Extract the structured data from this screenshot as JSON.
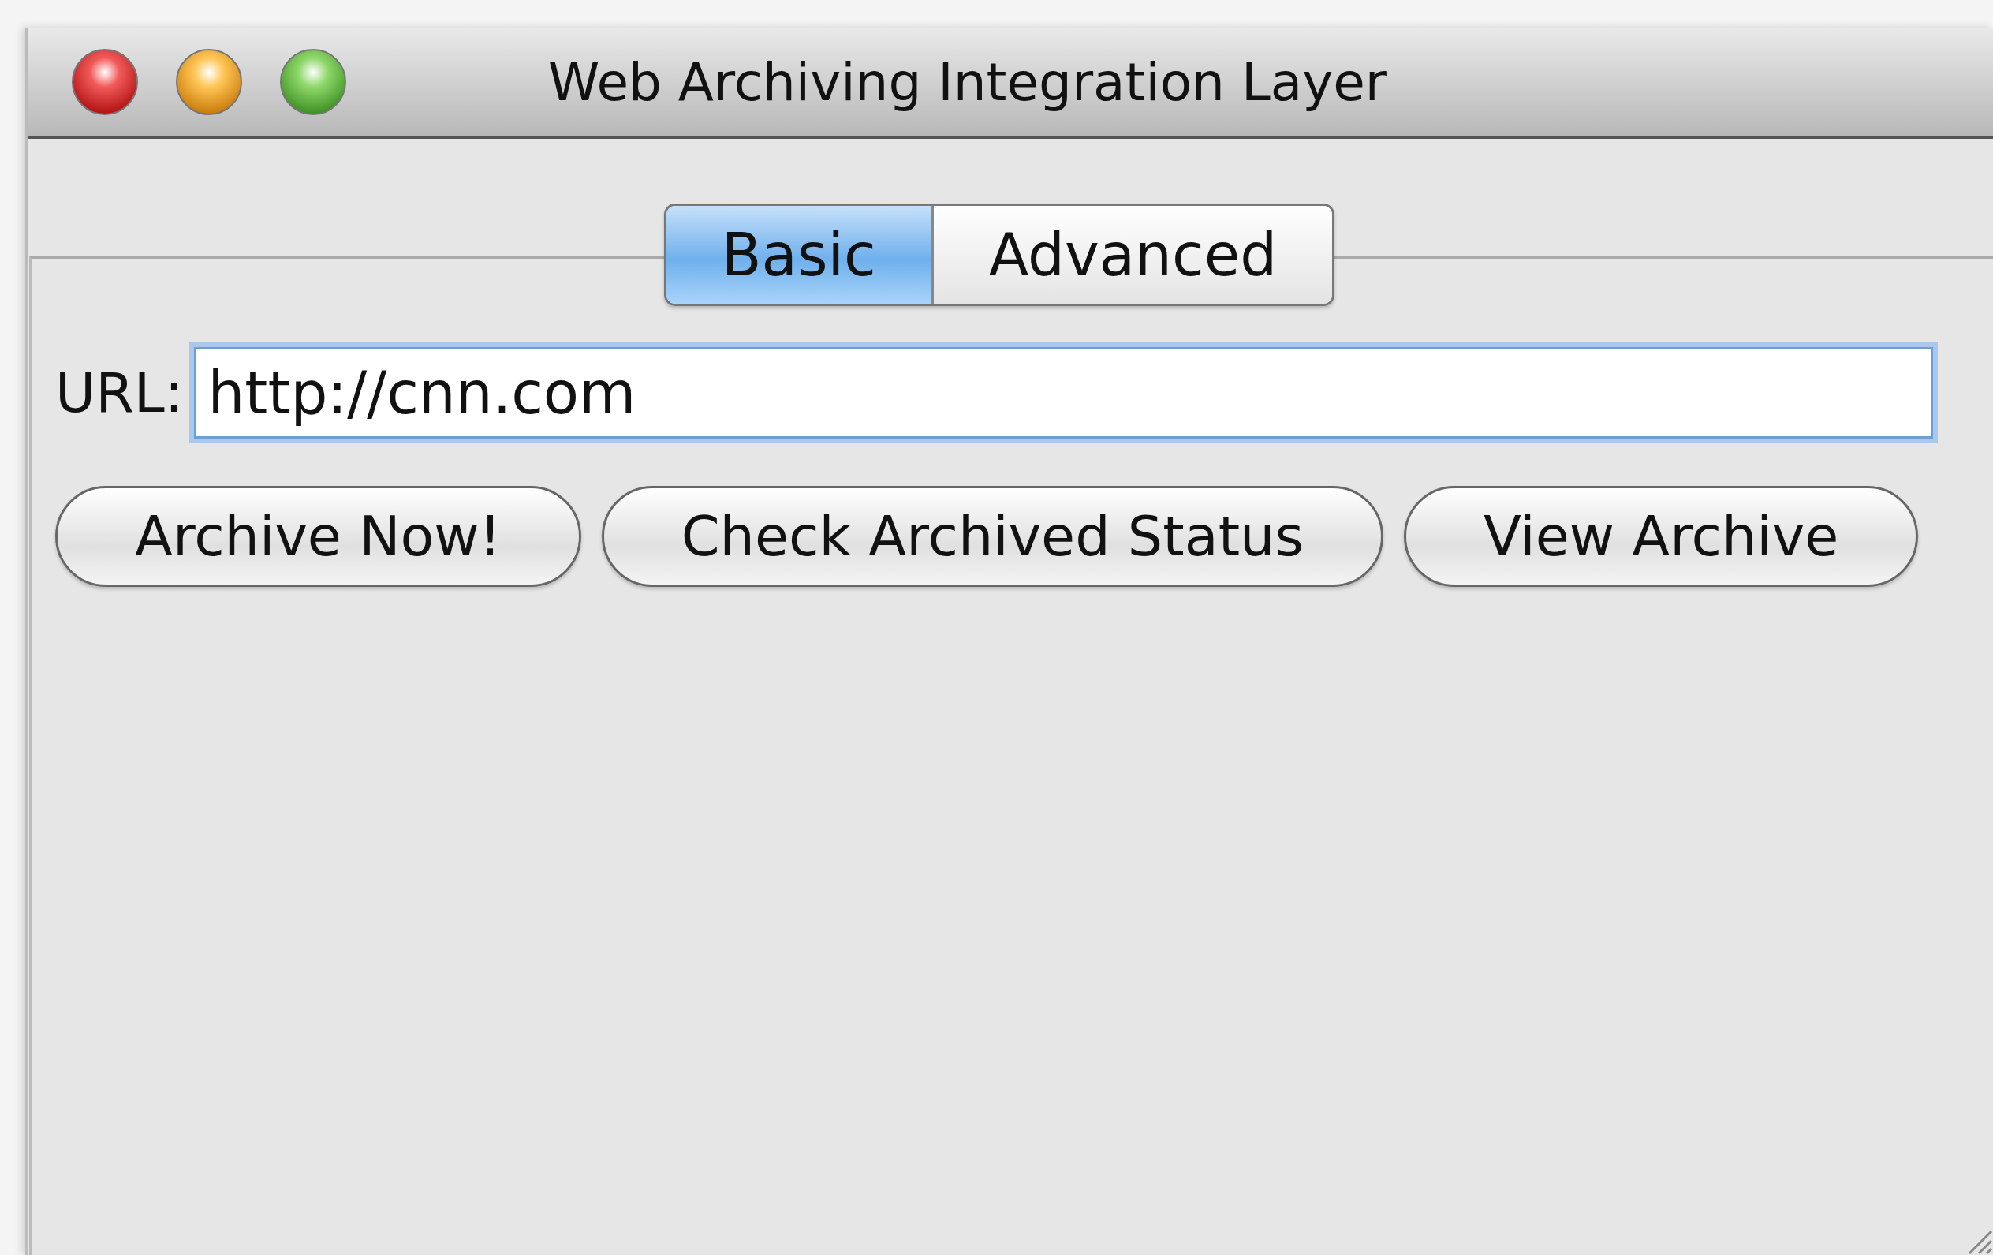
{
  "window": {
    "title": "Web Archiving Integration Layer"
  },
  "tabs": [
    {
      "label": "Basic",
      "selected": true
    },
    {
      "label": "Advanced",
      "selected": false
    }
  ],
  "url_field": {
    "label": "URL:",
    "value": "http://cnn.com",
    "focused": true
  },
  "buttons": [
    "Archive Now!",
    "Check Archived Status",
    "View Archive"
  ]
}
